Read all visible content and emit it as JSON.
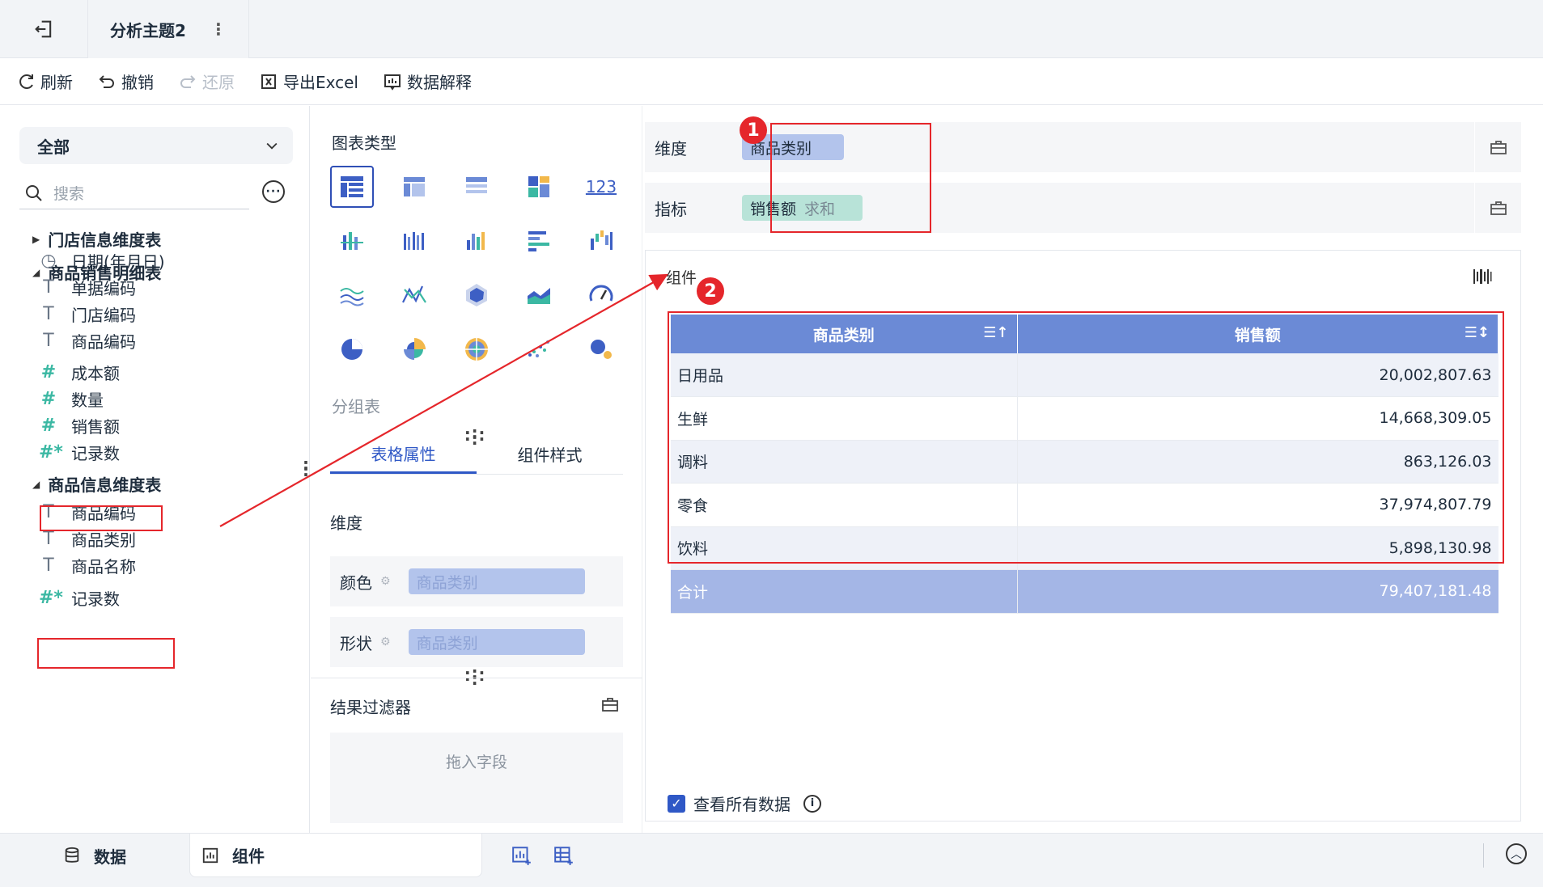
{
  "topbar": {
    "tab_title": "分析主题2",
    "more": "⋮"
  },
  "toolbar": {
    "refresh": "刷新",
    "undo": "撤销",
    "redo": "还原",
    "export": "导出Excel",
    "explain": "数据解释"
  },
  "left": {
    "scope": "全部",
    "search_placeholder": "搜索",
    "more": "···",
    "groups": [
      {
        "name": "门店信息维度表"
      },
      {
        "name": "商品销售明细表"
      },
      {
        "name": "商品信息维度表"
      }
    ],
    "items_sales": [
      "日期(年月日)",
      "单据编码",
      "门店编码",
      "商品编码",
      "成本额",
      "数量",
      "销售额",
      "记录数"
    ],
    "items_product": [
      "商品编码",
      "商品类别",
      "商品名称",
      "记录数"
    ]
  },
  "mid": {
    "chart_type_title": "图表类型",
    "selected_chart": "分组表",
    "chart_icon_123": "123",
    "tabs": [
      "表格属性",
      "组件样式"
    ],
    "dimension_label": "维度",
    "color_label": "颜色",
    "shape_label": "形状",
    "color_value": "商品类别",
    "shape_value": "商品类别",
    "filter_title": "结果过滤器",
    "drop_hint": "拖入字段"
  },
  "right": {
    "dimension_label": "维度",
    "measure_label": "指标",
    "dimension_pill": "商品类别",
    "measure_pill": "销售额",
    "measure_agg": "求和",
    "component_label": "组件",
    "table": {
      "headers": [
        "商品类别",
        "销售额"
      ],
      "rows": [
        [
          "日用品",
          "20,002,807.63"
        ],
        [
          "生鲜",
          "14,668,309.05"
        ],
        [
          "调料",
          "863,126.03"
        ],
        [
          "零食",
          "37,974,807.79"
        ],
        [
          "饮料",
          "5,898,130.98"
        ]
      ],
      "total": [
        "合计",
        "79,407,181.48"
      ]
    },
    "view_all": "查看所有数据",
    "info": "i"
  },
  "badges": [
    "1",
    "2"
  ],
  "bottom": {
    "data_tab": "数据",
    "component_tab": "组件"
  },
  "colors": {
    "accent": "#2f58c6",
    "header": "#6b8ad6",
    "highlight": "#e5262b",
    "dim_pill": "#b3c4ec",
    "mea_pill": "#b8e3d8"
  }
}
